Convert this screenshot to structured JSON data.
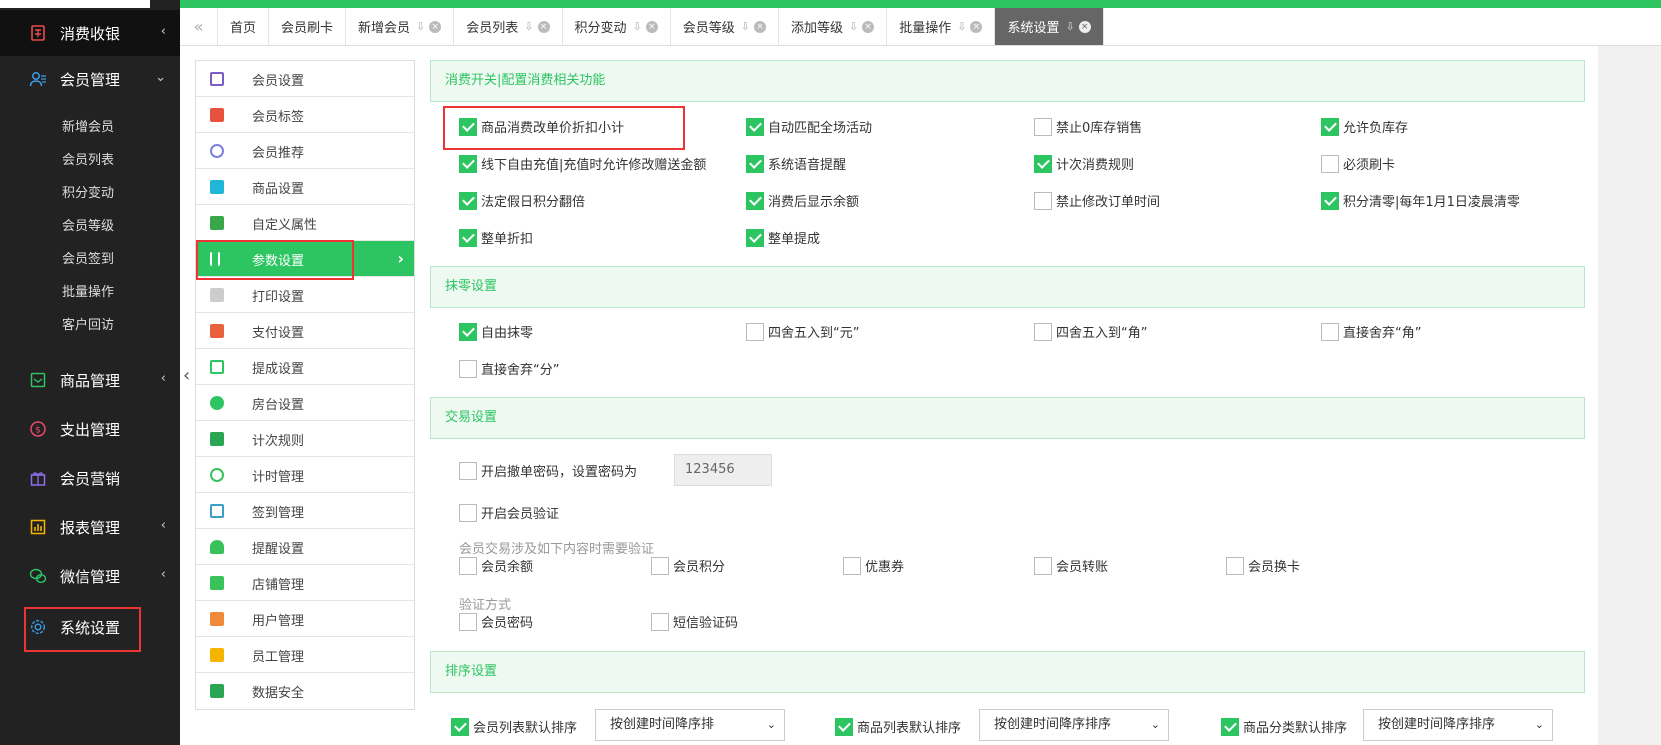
{
  "sidebar": {
    "groups": [
      {
        "label": "消费收银",
        "icon": "cashier-icon",
        "arrow": "‹"
      },
      {
        "label": "会员管理",
        "icon": "members-icon",
        "arrow": "⌄"
      },
      {
        "label": "商品管理",
        "icon": "goods-icon",
        "arrow": "‹"
      },
      {
        "label": "支出管理",
        "icon": "expense-icon",
        "arrow": ""
      },
      {
        "label": "会员营销",
        "icon": "gift-icon",
        "arrow": ""
      },
      {
        "label": "报表管理",
        "icon": "report-icon",
        "arrow": "‹"
      },
      {
        "label": "微信管理",
        "icon": "wechat-icon",
        "arrow": "‹"
      },
      {
        "label": "系统设置",
        "icon": "gear-icon",
        "arrow": ""
      }
    ],
    "subs": [
      "新增会员",
      "会员列表",
      "积分变动",
      "会员等级",
      "会员签到",
      "批量操作",
      "客户回访"
    ]
  },
  "tabs": [
    {
      "label": "首页"
    },
    {
      "label": "会员刷卡"
    },
    {
      "label": "新增会员"
    },
    {
      "label": "会员列表"
    },
    {
      "label": "积分变动"
    },
    {
      "label": "会员等级"
    },
    {
      "label": "添加等级"
    },
    {
      "label": "批量操作"
    },
    {
      "label": "系统设置"
    }
  ],
  "menu": [
    {
      "label": "会员设置",
      "color": "#7b5cc4"
    },
    {
      "label": "会员标签",
      "color": "#e8523d"
    },
    {
      "label": "会员推荐",
      "color": "#7b7fe0"
    },
    {
      "label": "商品设置",
      "color": "#1fb6d8"
    },
    {
      "label": "自定义属性",
      "color": "#3aa64a"
    },
    {
      "label": "参数设置",
      "color": "#ffffff"
    },
    {
      "label": "打印设置",
      "color": "#bbbbbb"
    },
    {
      "label": "支付设置",
      "color": "#e8623d"
    },
    {
      "label": "提成设置",
      "color": "#2dc462"
    },
    {
      "label": "房台设置",
      "color": "#2dc462"
    },
    {
      "label": "计次规则",
      "color": "#2aa653"
    },
    {
      "label": "计时管理",
      "color": "#37c25a"
    },
    {
      "label": "签到管理",
      "color": "#3aa0c8"
    },
    {
      "label": "提醒设置",
      "color": "#37c25a"
    },
    {
      "label": "店铺管理",
      "color": "#37c25a"
    },
    {
      "label": "用户管理",
      "color": "#f08a3a"
    },
    {
      "label": "员工管理",
      "color": "#f4b400"
    },
    {
      "label": "数据安全",
      "color": "#2aa653"
    }
  ],
  "sections": {
    "consume": "消费开关|配置消费相关功能",
    "rounding": "抹零设置",
    "trade": "交易设置",
    "sort": "排序设置"
  },
  "consume_opts": [
    {
      "label": "商品消费改单价折扣小计",
      "on": true
    },
    {
      "label": "自动匹配全场活动",
      "on": true
    },
    {
      "label": "禁止0库存销售",
      "on": false
    },
    {
      "label": "允许负库存",
      "on": true
    },
    {
      "label": "线下自由充值|充值时允许修改赠送金额",
      "on": true
    },
    {
      "label": "系统语音提醒",
      "on": true
    },
    {
      "label": "计次消费规则",
      "on": true
    },
    {
      "label": "必须刷卡",
      "on": false
    },
    {
      "label": "法定假日积分翻倍",
      "on": true
    },
    {
      "label": "消费后显示余额",
      "on": true
    },
    {
      "label": "禁止修改订单时间",
      "on": false
    },
    {
      "label": "积分清零|每年1月1日凌晨清零",
      "on": true
    },
    {
      "label": "整单折扣",
      "on": true
    },
    {
      "label": "整单提成",
      "on": true
    }
  ],
  "rounding_opts": [
    {
      "label": "自由抹零",
      "on": true
    },
    {
      "label": "四舍五入到“元”",
      "on": false
    },
    {
      "label": "四舍五入到“角”",
      "on": false
    },
    {
      "label": "直接舍弃“角”",
      "on": false
    },
    {
      "label": "直接舍弃“分”",
      "on": false
    }
  ],
  "trade": {
    "cancel_pwd_label": "开启撤单密码，设置密码为",
    "cancel_pwd_value": "123456",
    "member_verify_label": "开启会员验证",
    "verify_items_title": "会员交易涉及如下内容时需要验证",
    "verify_items": [
      "会员余额",
      "会员积分",
      "优惠券",
      "会员转账",
      "会员换卡"
    ],
    "verify_method_title": "验证方式",
    "verify_methods": [
      "会员密码",
      "短信验证码"
    ]
  },
  "sort": [
    {
      "label": "会员列表默认排序",
      "value": "按创建时间降序排"
    },
    {
      "label": "商品列表默认排序",
      "value": "按创建时间降序排序"
    },
    {
      "label": "商品分类默认排序",
      "value": "按创建时间降序排序"
    }
  ]
}
